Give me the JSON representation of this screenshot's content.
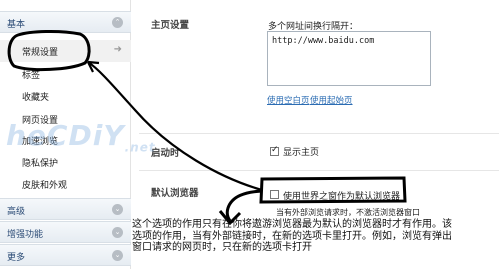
{
  "sidebar": {
    "basic_header": "基本",
    "items": [
      {
        "label": "常规设置"
      },
      {
        "label": "标签"
      },
      {
        "label": "收藏夹"
      },
      {
        "label": "网页设置"
      },
      {
        "label": "加速浏览"
      },
      {
        "label": "隐私保护"
      },
      {
        "label": "皮肤和外观"
      }
    ],
    "advanced_header": "高级",
    "enhanced_header": "增强功能",
    "more_header": "更多"
  },
  "main": {
    "homepage": {
      "label": "主页设置",
      "instruction": "多个网址间换行隔开：",
      "value": "http://www.baidu.com",
      "use_blank": "使用空白页",
      "use_current": "使用起始页"
    },
    "startup": {
      "label": "启动时",
      "checkbox_label": "显示主页",
      "checked": true
    },
    "default_browser": {
      "label": "默认浏览器",
      "checkbox_label": "使用世界之窗作为默认浏览器",
      "checked": false,
      "subnote": "当有外部浏览请求时，不激活浏览器窗口"
    }
  },
  "annotation": {
    "text": "这个选项的作用只有在你将遨游浏览器最为默认的浏览器时才有作用。该选项的作用，当有外部链接时，在新的选项卡里打开。例如，浏览有弹出窗口请求的网页时，只在新的选项卡打开"
  },
  "watermark": {
    "text": "heCDiY",
    "suffix": ".net"
  },
  "colors": {
    "link": "#2b6cb3",
    "header_text": "#2a4a75",
    "annotation_ink": "#000000"
  }
}
